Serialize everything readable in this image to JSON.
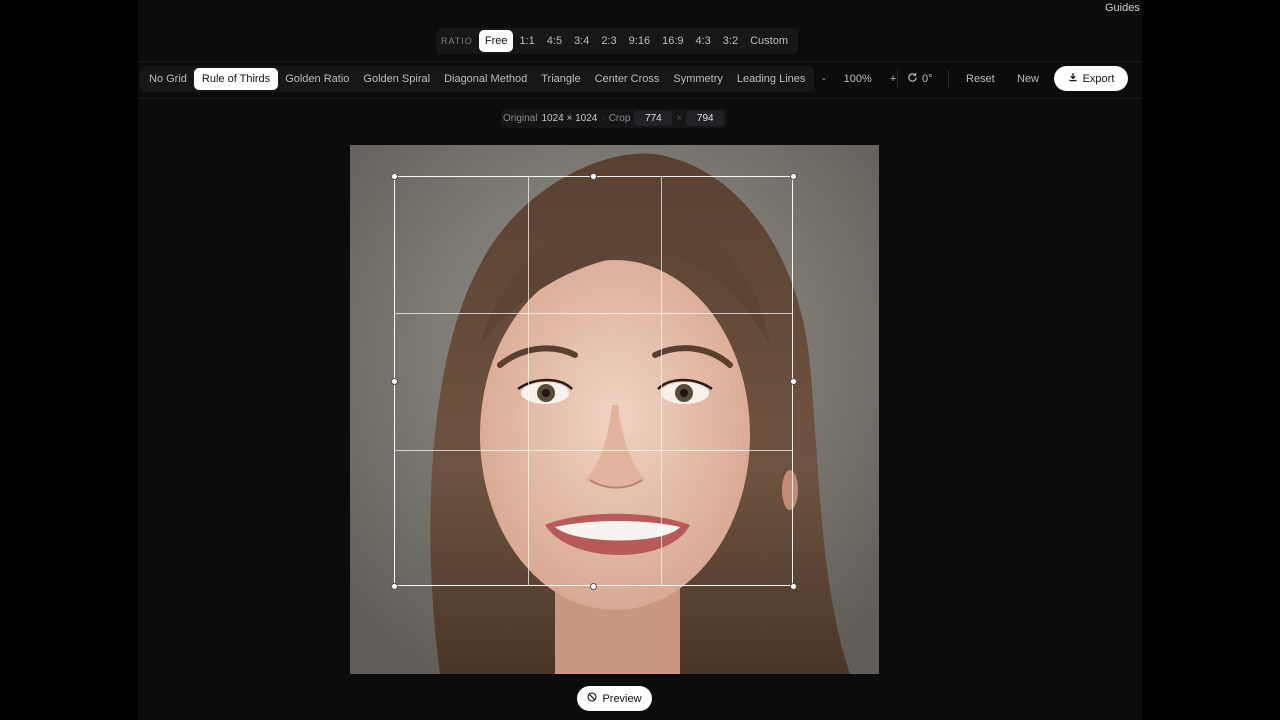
{
  "header": {
    "guides_label": "Guides"
  },
  "ratio": {
    "label": "RATIO",
    "options": [
      "Free",
      "1:1",
      "4:5",
      "3:4",
      "2:3",
      "9:16",
      "16:9",
      "4:3",
      "3:2",
      "Custom"
    ],
    "selected": "Free"
  },
  "grid": {
    "options": [
      "No Grid",
      "Rule of Thirds",
      "Golden Ratio",
      "Golden Spiral",
      "Diagonal Method",
      "Triangle",
      "Center Cross",
      "Symmetry",
      "Leading Lines"
    ],
    "selected": "Rule of Thirds"
  },
  "zoom": {
    "minus": "-",
    "value": "100%",
    "plus": "+"
  },
  "rotation": {
    "icon": "rotate-icon",
    "value": "0°"
  },
  "actions": {
    "reset": "Reset",
    "new": "New",
    "export": "Export",
    "export_icon": "download-icon"
  },
  "info": {
    "original_label": "Original",
    "original_value": "1024 × 1024",
    "separator": "·",
    "crop_label": "Crop",
    "crop_width": "774",
    "times": "×",
    "crop_height": "794"
  },
  "preview": {
    "label": "Preview",
    "icon": "eye-icon"
  },
  "colors": {
    "background": "#0c0c0d",
    "accent": "#ffffff",
    "panel": "#17171a"
  }
}
